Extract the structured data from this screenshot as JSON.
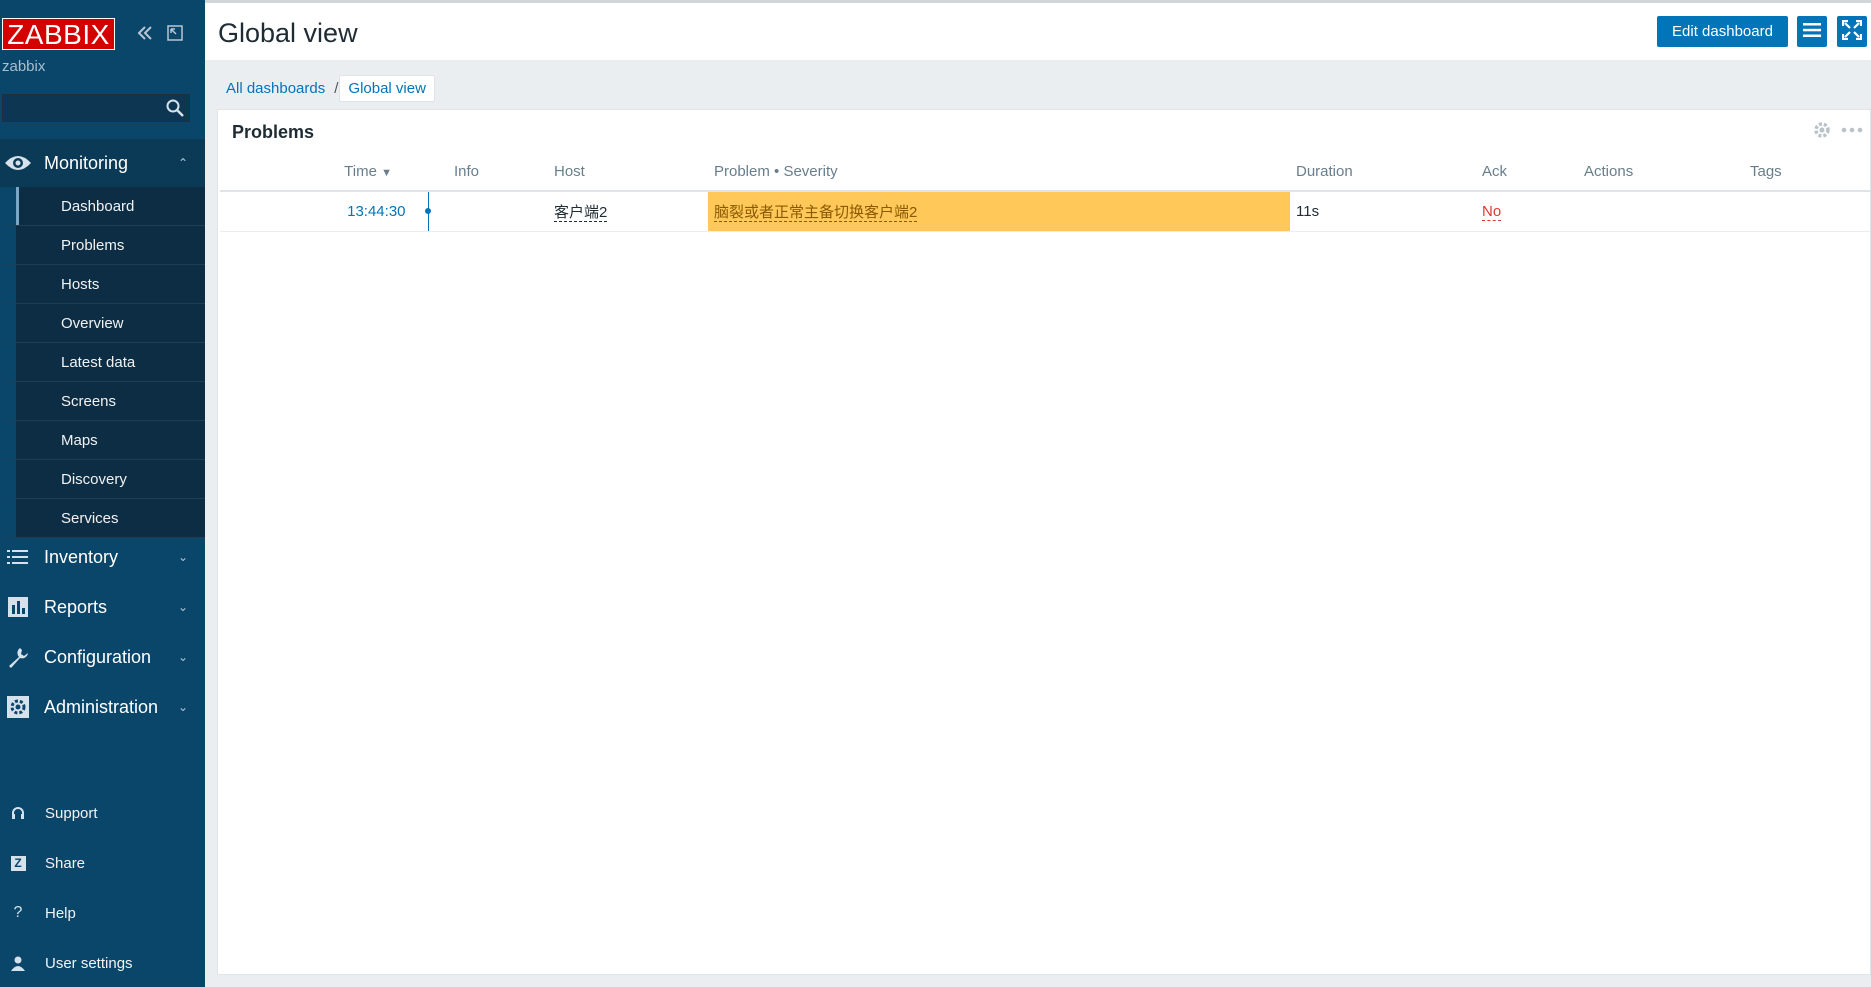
{
  "brand": {
    "logo_text": "ZABBIX",
    "logo_color": "#d40000",
    "server_name": "zabbix"
  },
  "search": {
    "value": "",
    "placeholder": ""
  },
  "menu": {
    "monitoring": {
      "label": "Monitoring",
      "icon": "eye-icon",
      "caret": "⌃",
      "items": [
        {
          "label": "Dashboard",
          "selected": true
        },
        {
          "label": "Problems"
        },
        {
          "label": "Hosts"
        },
        {
          "label": "Overview"
        },
        {
          "label": "Latest data"
        },
        {
          "label": "Screens"
        },
        {
          "label": "Maps"
        },
        {
          "label": "Discovery"
        },
        {
          "label": "Services"
        }
      ]
    },
    "inventory": {
      "label": "Inventory",
      "icon": "list-icon",
      "caret": "⌄"
    },
    "reports": {
      "label": "Reports",
      "icon": "bar-chart-icon",
      "caret": "⌄"
    },
    "configuration": {
      "label": "Configuration",
      "icon": "wrench-icon",
      "caret": "⌄"
    },
    "administration": {
      "label": "Administration",
      "icon": "gear-icon",
      "caret": "⌄"
    }
  },
  "bottom_menu": {
    "support": {
      "label": "Support",
      "icon": "headset-icon"
    },
    "share": {
      "label": "Share",
      "icon": "share-icon",
      "glyph": "Z"
    },
    "help": {
      "label": "Help",
      "icon": "help-icon",
      "glyph": "?"
    },
    "user_settings": {
      "label": "User settings",
      "icon": "user-icon"
    }
  },
  "header": {
    "title": "Global view",
    "edit_button": "Edit dashboard"
  },
  "breadcrumb": {
    "root": "All dashboards",
    "separator": "/",
    "current": "Global view"
  },
  "widget": {
    "title": "Problems",
    "columns": {
      "time": "Time",
      "time_sort": "▼",
      "info": "Info",
      "host": "Host",
      "problem": "Problem • Severity",
      "duration": "Duration",
      "ack": "Ack",
      "actions": "Actions",
      "tags": "Tags"
    },
    "rows": [
      {
        "time": "13:44:30",
        "info": "",
        "host": "客户端2",
        "problem": "脑裂或者正常主备切换客户端2",
        "severity_color": "#ffc859",
        "duration": "11s",
        "ack": "No",
        "actions": "",
        "tags": ""
      }
    ]
  },
  "colors": {
    "sidebar": "#0a466a",
    "accent": "#0275b8",
    "ack_no": "#e33734"
  }
}
